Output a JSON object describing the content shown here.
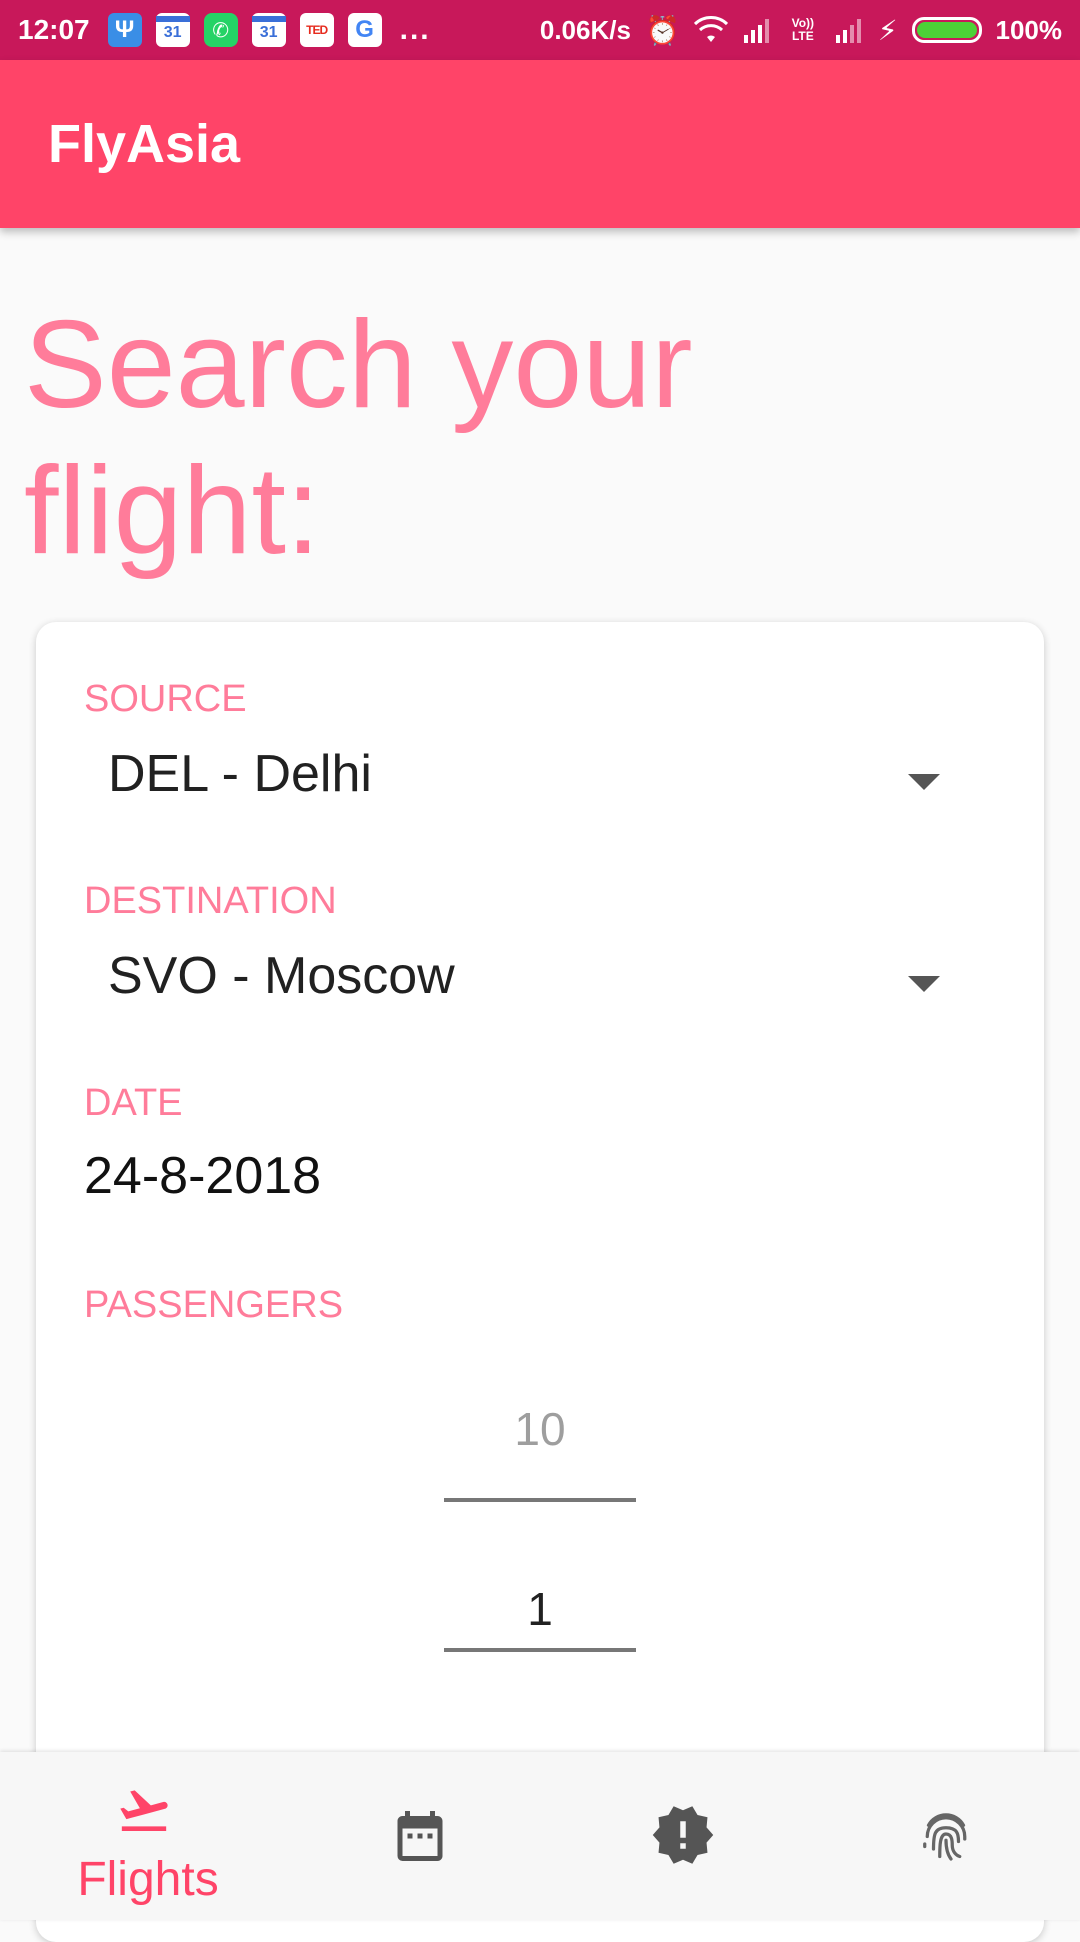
{
  "status_bar": {
    "time": "12:07",
    "calendar_day": "31",
    "ted": "TED",
    "google": "G",
    "more": "...",
    "network_speed": "0.06K/s",
    "volte": "Vo)) LTE",
    "battery_percent": "100%"
  },
  "app_bar": {
    "title": "FlyAsia"
  },
  "heading": "Search your flight:",
  "form": {
    "source_label": "SOURCE",
    "source_value": "DEL - Delhi",
    "destination_label": "DESTINATION",
    "destination_value": "SVO - Moscow",
    "date_label": "DATE",
    "date_value": "24-8-2018",
    "passengers_label": "PASSENGERS",
    "passengers_prev": "10",
    "passengers_value": "1"
  },
  "bottom_nav": {
    "items": [
      {
        "label": "Flights",
        "icon": "flight-takeoff-icon",
        "active": true
      },
      {
        "label": "",
        "icon": "calendar-icon",
        "active": false
      },
      {
        "label": "",
        "icon": "alert-badge-icon",
        "active": false
      },
      {
        "label": "",
        "icon": "fingerprint-icon",
        "active": false
      }
    ]
  },
  "colors": {
    "status_bar": "#c8185a",
    "app_bar": "#ff4468",
    "accent_light": "#ff7c9a",
    "inactive_icon": "#555555"
  }
}
